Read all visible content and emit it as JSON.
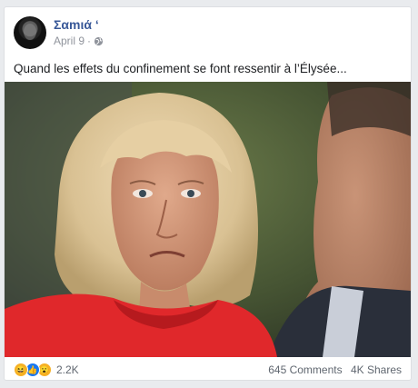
{
  "post": {
    "author": "Σαmιά ‘",
    "date": "April 9",
    "separator": "·",
    "privacy_icon": "globe-icon",
    "text": "Quand les effets du confinement se font ressentir à l’Élysée...",
    "image_description_icon": "photo",
    "reactions": {
      "icons": [
        "laugh-reaction-icon",
        "like-reaction-icon",
        "wow-reaction-icon"
      ],
      "count": "2.2K"
    },
    "comments": "645 Comments",
    "shares": "4K Shares"
  },
  "colors": {
    "name": "#385898",
    "meta": "#90949c",
    "background": "#e9ebee",
    "like_blue": "#1877f2",
    "reaction_yellow": "#f7b125"
  }
}
